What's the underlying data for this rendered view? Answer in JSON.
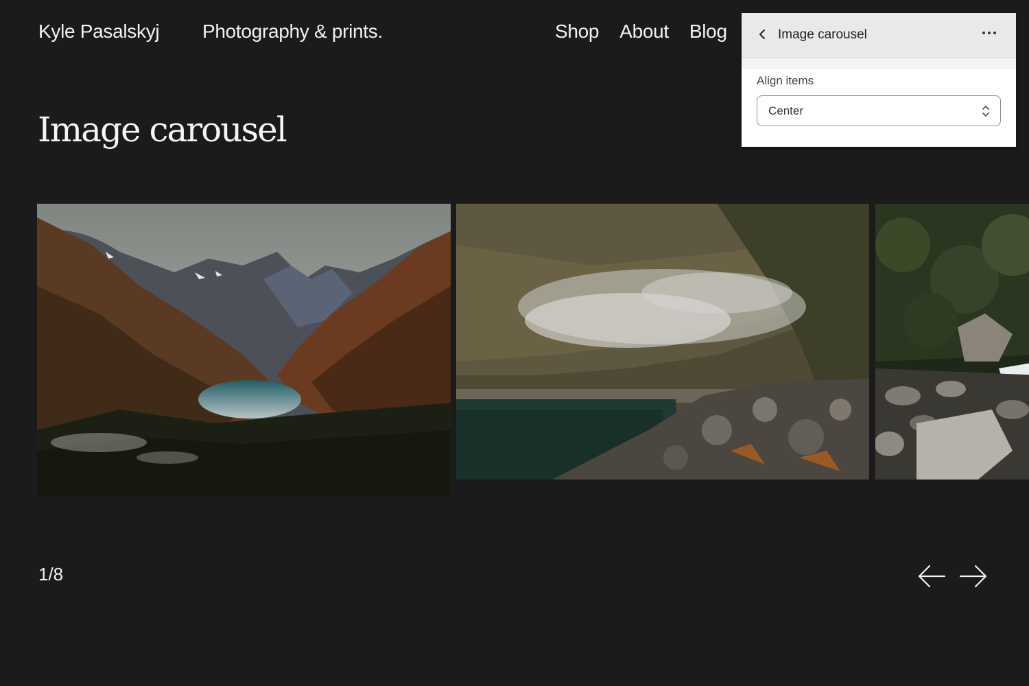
{
  "header": {
    "brand": "Kyle Pasalskyj",
    "tagline": "Photography & prints.",
    "nav": [
      "Shop",
      "About",
      "Blog"
    ]
  },
  "main": {
    "title": "Image carousel",
    "counter": "1/8",
    "slides": [
      {
        "name": "mountain-lake-valley"
      },
      {
        "name": "misty-lake-rocks"
      },
      {
        "name": "forest-river-boulders"
      }
    ],
    "icons": {
      "prev": "arrow-left-icon",
      "next": "arrow-right-icon"
    }
  },
  "panel": {
    "title": "Image carousel",
    "field_label": "Align items",
    "select_value": "Center",
    "icons": {
      "back": "chevron-left-icon",
      "more": "more-horizontal-icon",
      "select": "chevron-up-down-icon"
    }
  },
  "colors": {
    "background": "#1b1b1b",
    "text": "#f2f2f2",
    "panel_header": "#e9e9e9",
    "panel_body": "#ffffff"
  }
}
